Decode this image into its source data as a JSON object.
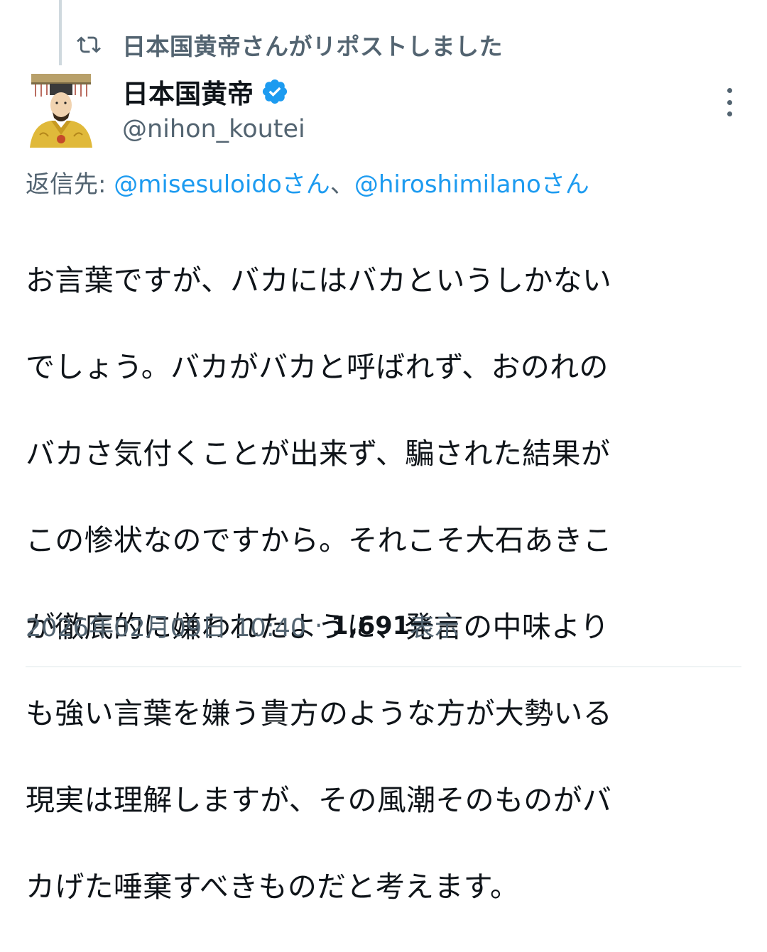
{
  "repost": {
    "icon": "repost-icon",
    "text": "日本国黄帝さんがリポストしました"
  },
  "author": {
    "avatar_icon": "emperor-portrait-avatar",
    "display_name": "日本国黄帝",
    "verified_icon": "verified-badge-icon",
    "handle": "@nihon_koutei"
  },
  "menu": {
    "icon": "more-vertical-icon"
  },
  "reply": {
    "prefix": "返信先: ",
    "mention1": "@misesuloidoさん",
    "separator": "、",
    "mention2": "@hiroshimilanoさん"
  },
  "tweet": {
    "lines": [
      "お言葉ですが、バカにはバカというしかない",
      "でしょう。バカがバカと呼ばれず、おのれの",
      "バカさ気付くことが出来ず、騙された結果が",
      "この惨状なのですから。それこそ大石あきこ",
      "が徹底的に嫌われたように、発言の中味より",
      "も強い言葉を嫌う貴方のような方が大勢いる",
      "現実は理解しますが、その風潮そのものがバ",
      "カげた唾棄すべきものだと考えます。"
    ]
  },
  "meta": {
    "timestamp": "2026年02月09日 10:40",
    "dot": "·",
    "views_count": "1,691",
    "views_label": " 表示"
  },
  "colors": {
    "text": "#0f1419",
    "secondary": "#536471",
    "link": "#1d9bf0",
    "line": "#cfd9de"
  }
}
